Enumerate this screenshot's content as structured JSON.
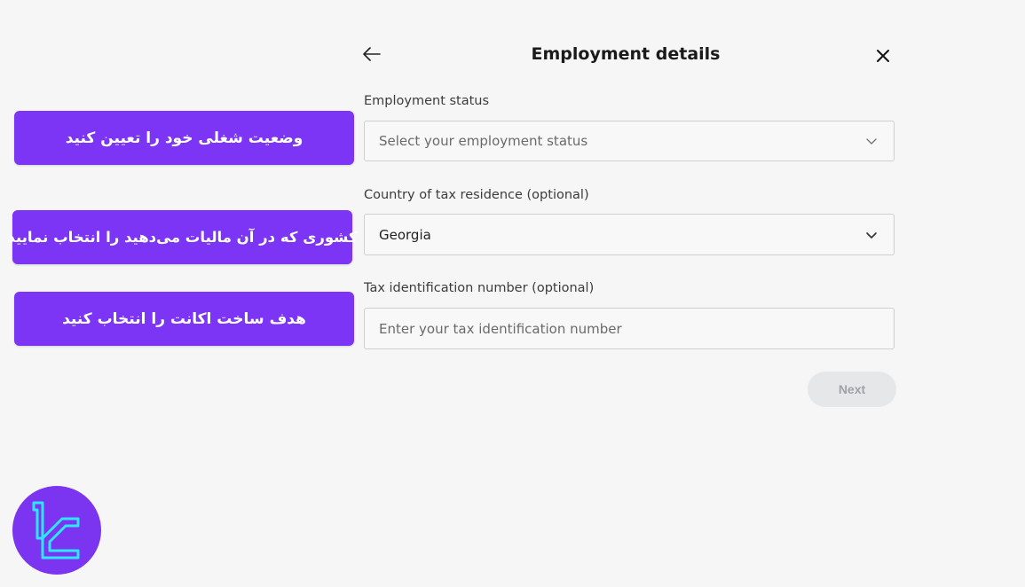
{
  "header": {
    "title": "Employment details",
    "back_icon": "arrow-left-icon",
    "close_icon": "close-icon"
  },
  "form": {
    "employment_status": {
      "label": "Employment status",
      "placeholder": "Select your employment status",
      "icon": "chevron-down-icon"
    },
    "tax_country": {
      "label": "Country of tax residence (optional)",
      "value": "Georgia",
      "icon": "chevron-down-icon"
    },
    "tax_id": {
      "label": "Tax identification number (optional)",
      "placeholder": "Enter your tax identification number"
    },
    "next_label": "Next"
  },
  "annotations": [
    "وضعیت شغلی خود را تعیین کنید",
    "کشوری که در آن مالیات می‌دهید را انتخاب نمایید",
    "هدف ساخت اکانت را انتخاب کنید"
  ],
  "logo": {
    "icon": "brand-logo-icon",
    "accent": "#2ee6ff",
    "background": "#7b34f0"
  },
  "colors": {
    "callout": "#7c35f5",
    "page_background": "#f6f6f6",
    "next_disabled": "#e6e7e9"
  }
}
